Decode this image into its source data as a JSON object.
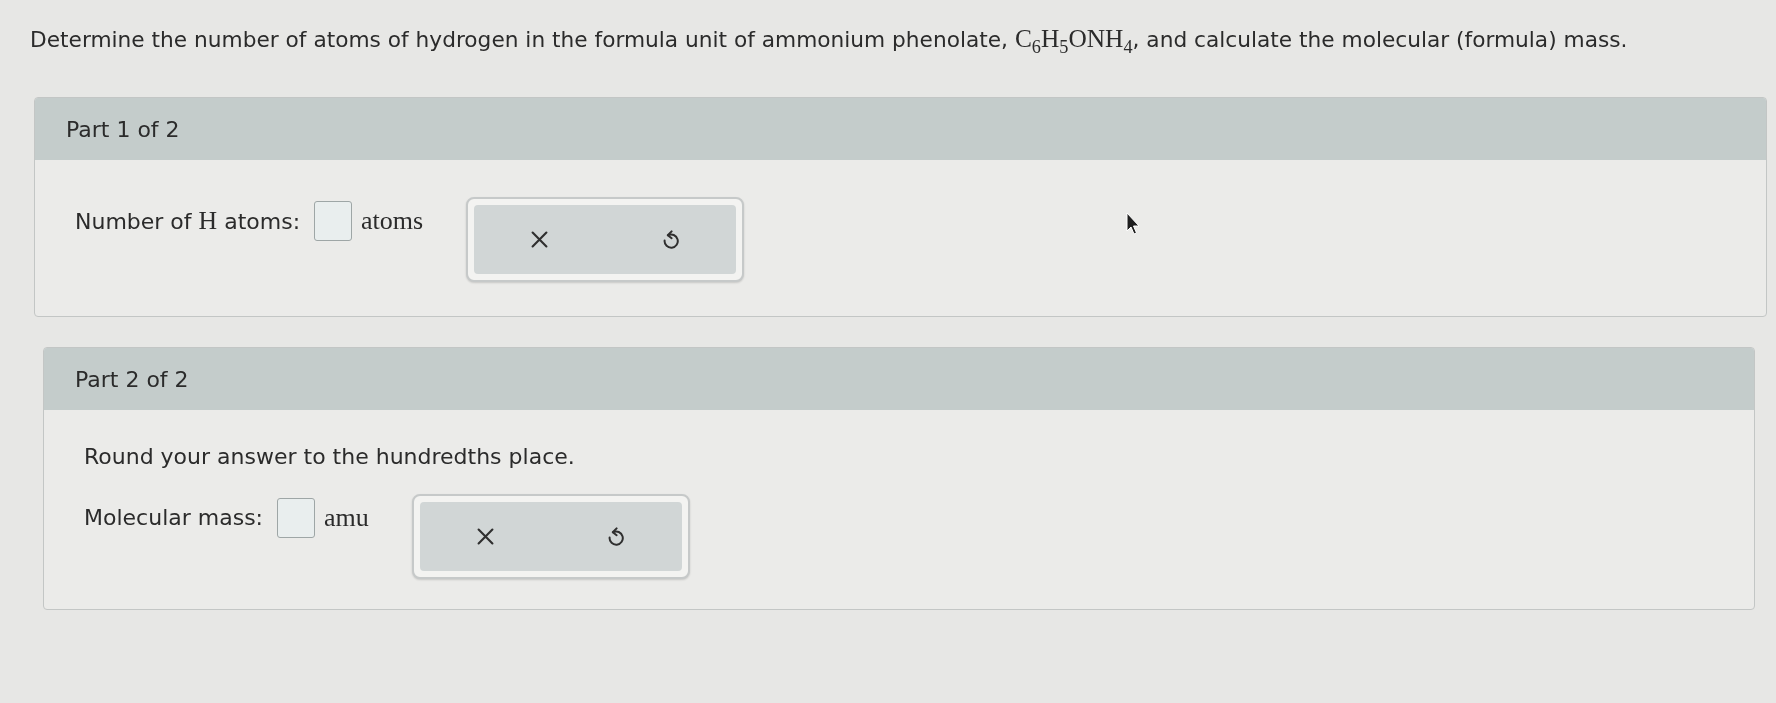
{
  "question": {
    "segments": [
      {
        "kind": "text",
        "text": "Determine the number of atoms of hydrogen in the formula unit of ammonium phenolate, "
      },
      {
        "kind": "math",
        "text": "C$_{6}$H$_{5}$ONH$_{4}$"
      },
      {
        "kind": "text",
        "text": ", and calculate the molecular (formula) mass."
      }
    ]
  },
  "parts": [
    {
      "title": "Part 1 of 2",
      "answer": {
        "label": [
          {
            "kind": "text",
            "text": "Number of "
          },
          {
            "kind": "math",
            "text": "H"
          },
          {
            "kind": "text",
            "text": " atoms:"
          }
        ],
        "unit": "atoms"
      },
      "buttons": [
        {
          "kind": "clear"
        },
        {
          "kind": "undo"
        }
      ]
    },
    {
      "title": "Part 2 of 2",
      "instruction": "Round your answer to the hundredths place.",
      "answer": {
        "label": [
          {
            "kind": "text",
            "text": "Molecular mass:"
          }
        ],
        "unit": "amu"
      },
      "buttons": [
        {
          "kind": "clear"
        },
        {
          "kind": "undo"
        }
      ]
    }
  ]
}
